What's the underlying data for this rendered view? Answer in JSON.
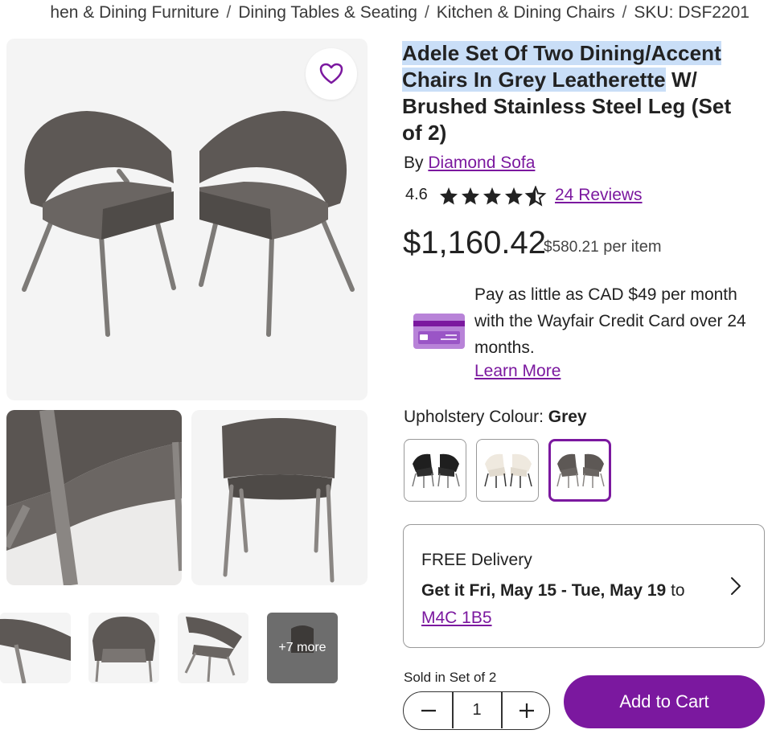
{
  "breadcrumb": {
    "items": [
      "hen & Dining Furniture",
      "Dining Tables & Seating",
      "Kitchen & Dining Chairs"
    ],
    "separator": "/",
    "sku": "SKU: DSF2201"
  },
  "gallery": {
    "more_label": "+7 more"
  },
  "product": {
    "title_highlighted": "Adele Set Of Two Dining/Accent Chairs In Grey Leatherette",
    "title_rest": " W/ Brushed Stainless Steel Leg (Set of 2)",
    "by_prefix": "By",
    "brand": "Diamond Sofa",
    "rating": "4.6",
    "rating_value": 4.6,
    "rating_max": 5,
    "reviews": "24 Reviews",
    "price": "$1,160.42",
    "per_item_price": "$580.21",
    "per_item_suffix": "per item"
  },
  "financing": {
    "text": "Pay as little as CAD $49 per month with the Wayfair Credit Card over 24 months.",
    "learn_more": "Learn More"
  },
  "options": {
    "label": "Upholstery Colour:",
    "selected": "Grey"
  },
  "delivery": {
    "title": "FREE Delivery",
    "date_prefix": "Get it",
    "date_range": "Fri, May 15 - Tue, May 19",
    "to": "to",
    "postal_code": "M4C 1B5"
  },
  "purchase": {
    "sold_in": "Sold in Set of 2",
    "quantity": "1",
    "add_to_cart": "Add to Cart"
  },
  "colors": {
    "accent": "#7b189f",
    "highlight": "#c9def7"
  },
  "icons": [
    "heart-icon",
    "star-icon",
    "half-star-icon",
    "credit-card-icon",
    "chevron-right-icon",
    "minus-icon",
    "plus-icon"
  ]
}
